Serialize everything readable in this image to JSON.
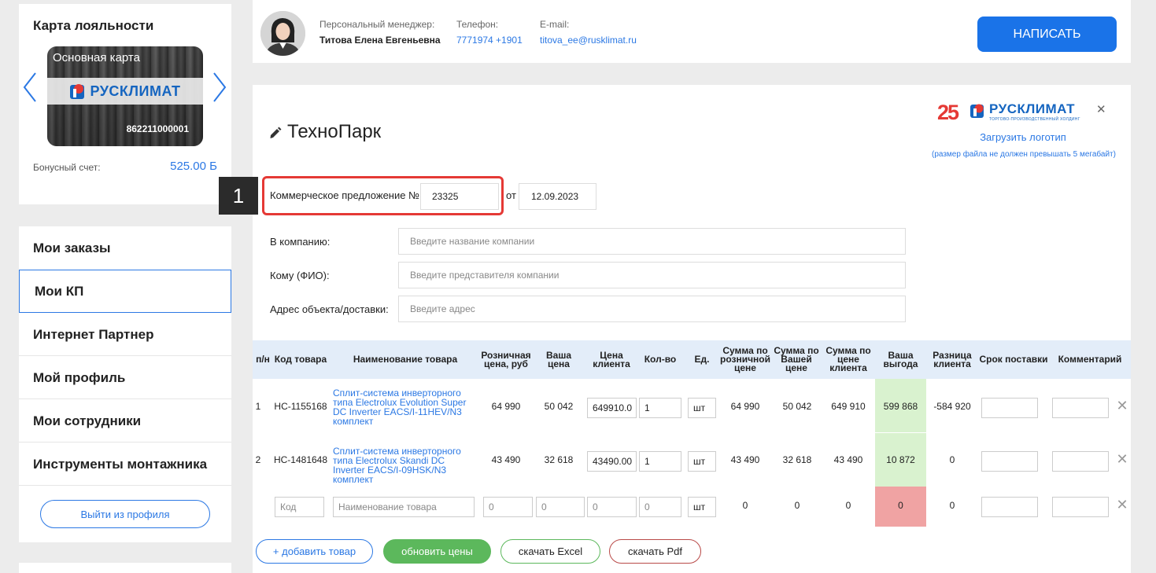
{
  "loyalty": {
    "title": "Карта лояльности",
    "card_name": "Основная карта",
    "card_brand": "РУСКЛИМАТ",
    "card_number": "862211000001",
    "bonus_label": "Бонусный счет:",
    "bonus_value": "525.00 Б"
  },
  "menu": {
    "items": [
      "Мои заказы",
      "Мои КП",
      "Интернет Партнер",
      "Мой профиль",
      "Мои сотрудники",
      "Инструменты монтажника"
    ],
    "active_index": 1,
    "logout_label": "Выйти из профиля"
  },
  "manager": {
    "role_label": "Персональный менеджер:",
    "name": "Титова Елена Евгеньевна",
    "phone_label": "Телефон:",
    "phone": "7771974 +1901",
    "email_label": "E-mail:",
    "email": "titova_ee@rusklimat.ru",
    "write_button": "НАПИСАТЬ"
  },
  "doc": {
    "title": "ТехноПарк",
    "logo_anniversary": "25",
    "logo_brand": "РУСКЛИМАТ",
    "logo_tagline": "ТОРГОВО-ПРОИЗВОДСТВЕННЫЙ ХОЛДИНГ",
    "upload_logo": "Загрузить логотип",
    "upload_hint": "(размер файла не должен превышать 5 мегабайт)",
    "step_badge": "1",
    "kp_label": "Коммерческое предложение №",
    "kp_number": "23325",
    "date_prefix": "от",
    "kp_date": "12.09.2023",
    "fields": [
      {
        "label": "В компанию:",
        "placeholder": "Введите название компании"
      },
      {
        "label": "Кому (ФИО):",
        "placeholder": "Введите представителя компании"
      },
      {
        "label": "Адрес объекта/доставки:",
        "placeholder": "Введите адрес"
      }
    ]
  },
  "table": {
    "headers": [
      "п/н",
      "Код товара",
      "Наименование товара",
      "Розничная цена, руб",
      "Ваша цена",
      "Цена клиента",
      "Кол-во",
      "Ед.",
      "Сумма по розничной цене",
      "Сумма по Вашей цене",
      "Сумма по цене клиента",
      "Ваша выгода",
      "Разница клиента",
      "Срок поставки",
      "Комментарий"
    ],
    "rows": [
      {
        "num": "1",
        "code": "НС-1155168",
        "name": "Сплит-система инверторного типа Electrolux Evolution Super DC Inverter EACS/I-11HEV/N3 комплект",
        "retail": "64 990",
        "your_price": "50 042",
        "client_price": "649910.0",
        "qty": "1",
        "unit": "шт",
        "sum_retail": "64 990",
        "sum_your": "50 042",
        "sum_client": "649 910",
        "profit": "599 868",
        "diff": "-584 920"
      },
      {
        "num": "2",
        "code": "НС-1481648",
        "name": "Сплит-система инверторного типа Electrolux Skandi DC Inverter EACS/I-09HSK/N3 комплект",
        "retail": "43 490",
        "your_price": "32 618",
        "client_price": "43490.00",
        "qty": "1",
        "unit": "шт",
        "sum_retail": "43 490",
        "sum_your": "32 618",
        "sum_client": "43 490",
        "profit": "10 872",
        "diff": "0"
      }
    ],
    "new_row": {
      "code_placeholder": "Код",
      "name_placeholder": "Наименование товара",
      "retail": "0",
      "your_price": "0",
      "client_price": "0",
      "qty": "0",
      "unit": "шт",
      "sum_retail": "0",
      "sum_your": "0",
      "sum_client": "0",
      "profit": "0",
      "diff": "0"
    }
  },
  "actions": {
    "add": "+ добавить товар",
    "refresh": "обновить цены",
    "excel": "скачать Excel",
    "pdf": "скачать Pdf"
  },
  "colors": {
    "accent": "#1a73e8",
    "highlight": "#e53935",
    "profit_positive": "#d9f2cf",
    "profit_zero": "#f0a3a3"
  }
}
